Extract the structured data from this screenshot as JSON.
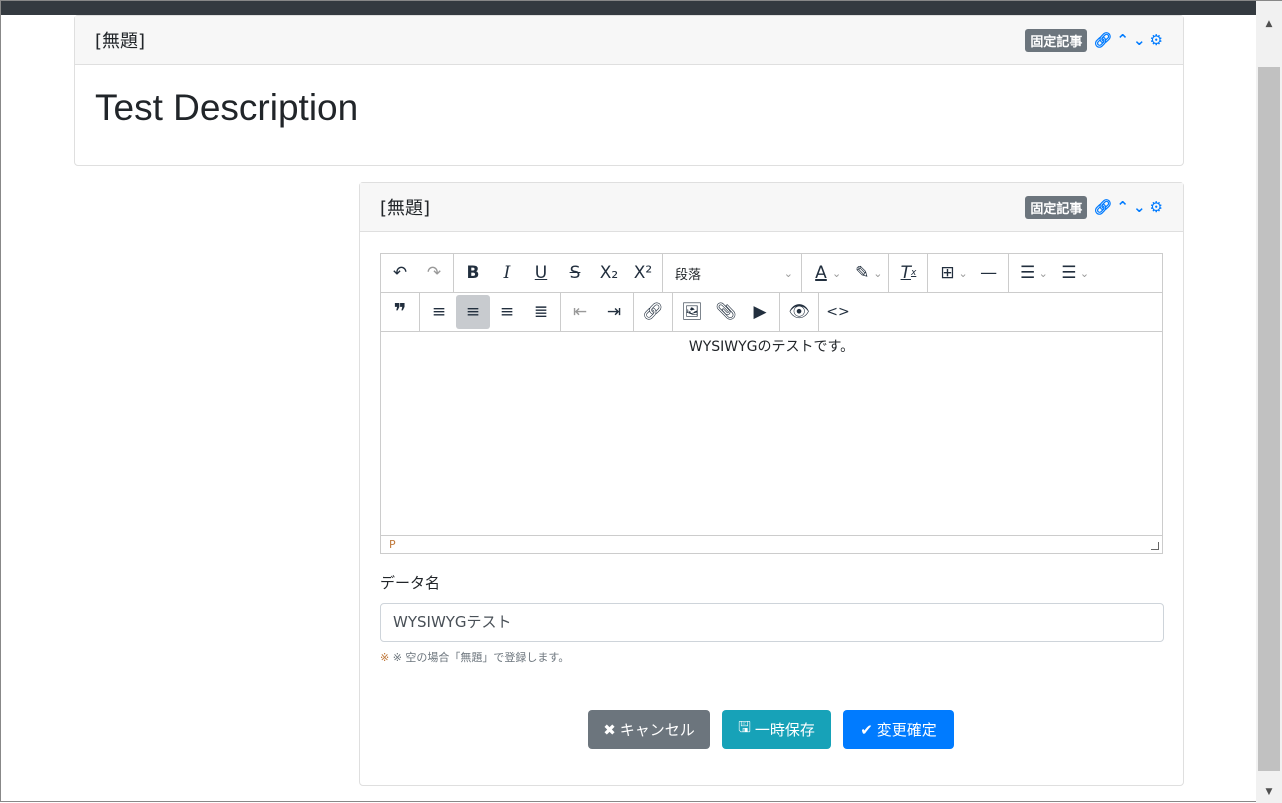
{
  "card1": {
    "title": "[無題]",
    "badge": "固定記事",
    "body": "Test Description"
  },
  "card2": {
    "title": "[無題]",
    "badge": "固定記事"
  },
  "editor": {
    "format_select": "段落",
    "content": "WYSIWYGのテストです。",
    "status_path": "P"
  },
  "form": {
    "label": "データ名",
    "value": "WYSIWYGテスト",
    "help": "※ 空の場合「無題」で登録します。"
  },
  "buttons": {
    "cancel": "キャンセル",
    "save": "一時保存",
    "confirm": "変更確定"
  },
  "colors": {
    "primary": "#007bff",
    "secondary": "#6c757d",
    "info": "#17a2b8"
  }
}
